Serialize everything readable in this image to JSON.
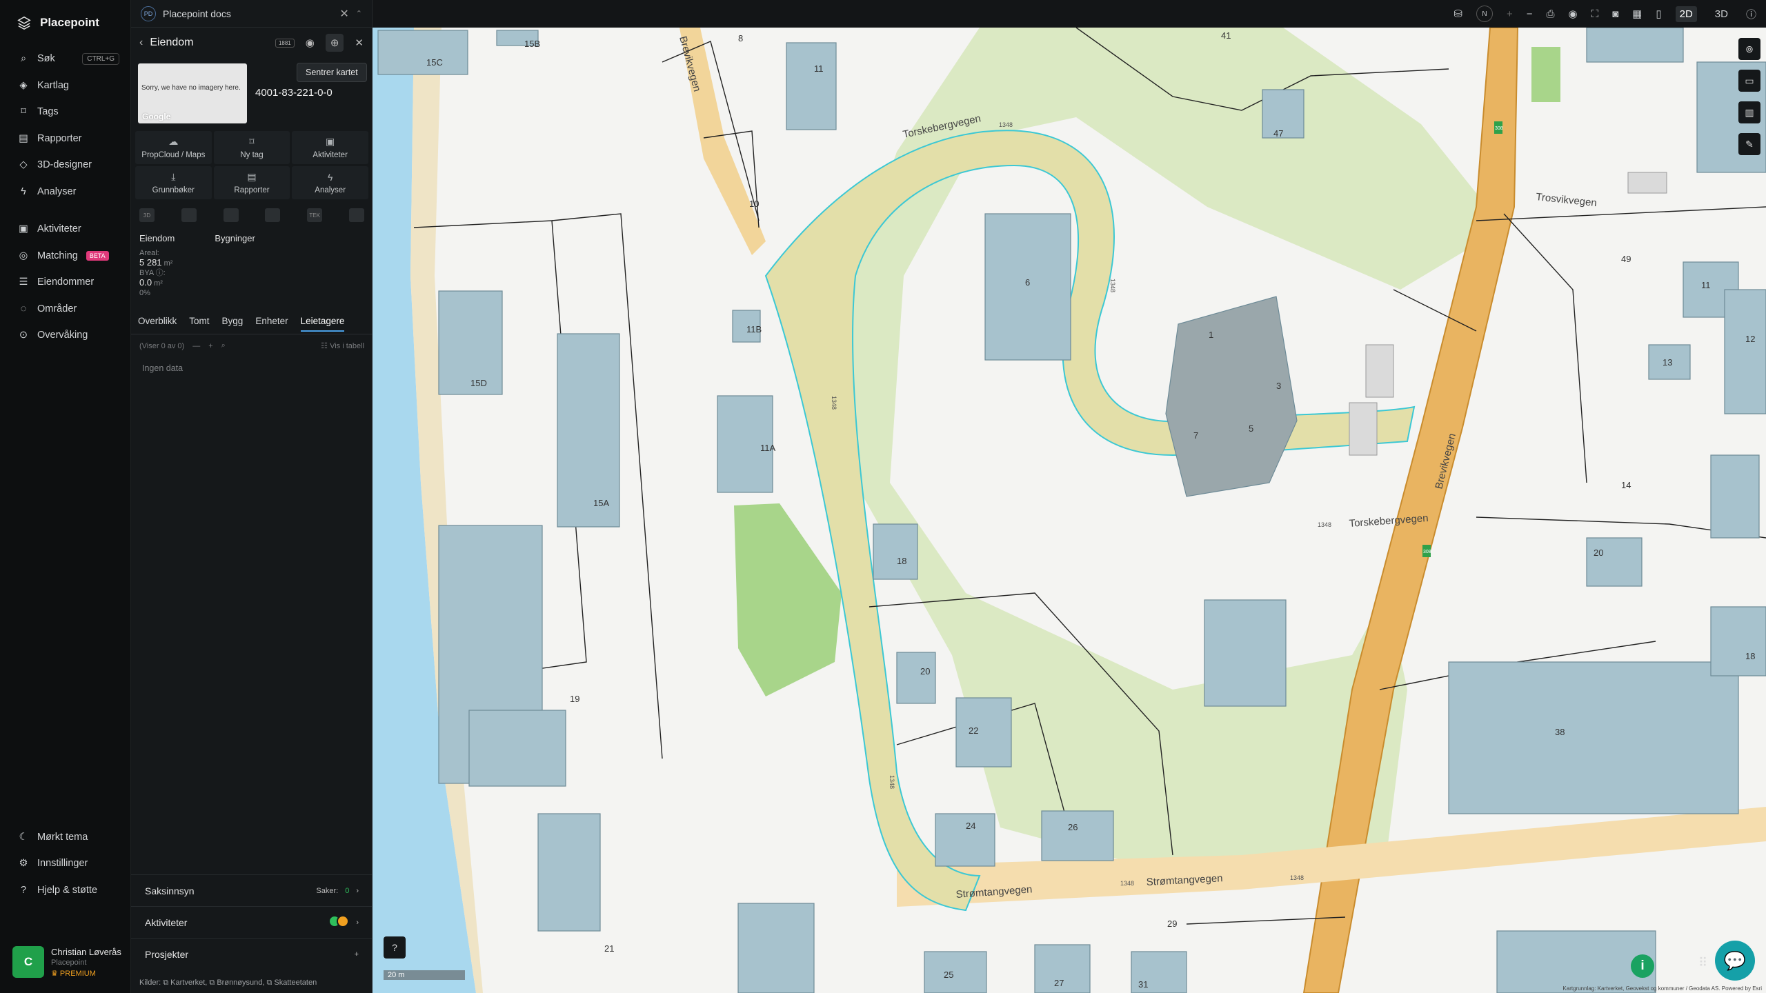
{
  "nav": {
    "brand": "Placepoint",
    "items": [
      {
        "label": "Søk",
        "icon": "search-icon",
        "kbd": "CTRL+G"
      },
      {
        "label": "Kartlag",
        "icon": "layers-icon"
      },
      {
        "label": "Tags",
        "icon": "bookmark-icon"
      },
      {
        "label": "Rapporter",
        "icon": "chart-icon"
      },
      {
        "label": "3D-designer",
        "icon": "cube-icon"
      },
      {
        "label": "Analyser",
        "icon": "bolt-icon"
      }
    ],
    "items2": [
      {
        "label": "Aktiviteter",
        "icon": "chat-icon"
      },
      {
        "label": "Matching",
        "icon": "users-icon",
        "badge": "BETA"
      },
      {
        "label": "Eiendommer",
        "icon": "list-icon"
      },
      {
        "label": "Områder",
        "icon": "area-icon"
      },
      {
        "label": "Overvåking",
        "icon": "monitor-icon"
      }
    ],
    "bottom": [
      {
        "label": "Mørkt tema",
        "icon": "moon-icon"
      },
      {
        "label": "Innstillinger",
        "icon": "gear-icon"
      },
      {
        "label": "Hjelp & støtte",
        "icon": "help-icon"
      }
    ],
    "user": {
      "initial": "C",
      "name": "Christian Løverås",
      "org": "Placepoint",
      "plan": "PREMIUM"
    }
  },
  "panel": {
    "doc_badge": "PD",
    "doc_title": "Placepoint docs",
    "title": "Eiendom",
    "tooltip": "Sentrer kartet",
    "image_text": "Sorry, we have no imagery here.",
    "image_brand": "Google",
    "property_id": "4001-83-221-0-0",
    "actions": [
      {
        "label": "PropCloud / Maps",
        "icon": "cloud-icon"
      },
      {
        "label": "Ny tag",
        "icon": "bookmark-icon"
      },
      {
        "label": "Aktiviteter",
        "icon": "chat-icon"
      },
      {
        "label": "Grunnbøker",
        "icon": "download-icon"
      },
      {
        "label": "Rapporter",
        "icon": "chart-icon"
      },
      {
        "label": "Analyser",
        "icon": "bolt-icon"
      }
    ],
    "layer_labels": [
      "3D",
      "",
      "",
      "",
      "TEK",
      ""
    ],
    "subtabs": [
      "Eiendom",
      "Bygninger"
    ],
    "stats": {
      "areal_label": "Areal:",
      "areal_value": "5 281",
      "unit": "m²",
      "bya_label": "BYA ⓘ:",
      "bya_value": "0.0",
      "bya_pct": "0%"
    },
    "tabs": [
      "Overblikk",
      "Tomt",
      "Bygg",
      "Enheter",
      "Leietagere"
    ],
    "active_tab": "Leietagere",
    "list_count": "(Viser 0 av 0)",
    "list_toggle": "Vis i tabell",
    "no_data": "Ingen data",
    "sections": [
      {
        "label": "Saksinnsyn",
        "right": "Saker:",
        "count": "0"
      },
      {
        "label": "Aktiviteter"
      },
      {
        "label": "Prosjekter",
        "right": "+"
      }
    ],
    "sources_label": "Kilder:",
    "sources": [
      "Kartverket,",
      "Brønnøysund,",
      "Skatteetaten"
    ]
  },
  "map": {
    "mode_2d": "2D",
    "mode_3d": "3D",
    "north": "N",
    "scale": "20 m",
    "streets": [
      "Torskebergvegen",
      "Torskebergvegen",
      "Strømtangvegen",
      "Strømtangvegen",
      "Trosvikvegen",
      "Brevikvegen",
      "Brevikvegen"
    ],
    "road_ids": [
      "1348",
      "1348",
      "1348",
      "1348",
      "1348",
      "1348",
      "1348"
    ],
    "route": "308",
    "house_numbers": [
      "15C",
      "15B",
      "8",
      "11",
      "41",
      "47",
      "10",
      "6",
      "49",
      "11",
      "12",
      "11B",
      "1",
      "3",
      "5",
      "7",
      "13",
      "15D",
      "11A",
      "15A",
      "18",
      "14",
      "20",
      "20",
      "22",
      "18",
      "19",
      "38",
      "24",
      "26",
      "29",
      "21",
      "25",
      "27",
      "31"
    ],
    "attribution": "Kartgrunnlag: Kartverket, Geovekst og kommuner / Geodata AS. Powered by Esri"
  }
}
